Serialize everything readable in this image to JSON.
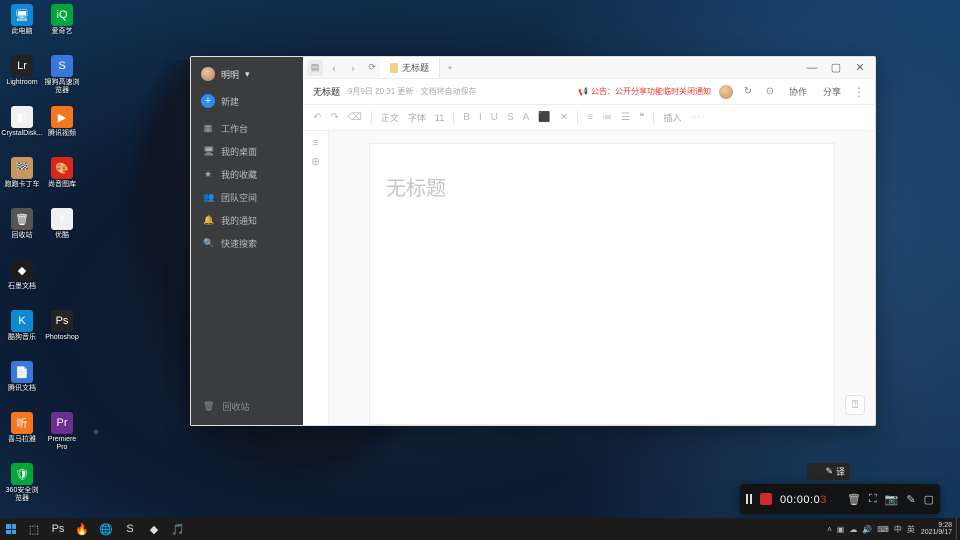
{
  "desktop_icons": [
    {
      "label": "此电脑",
      "cls": "c-blue",
      "glyph": "🖥"
    },
    {
      "label": "Lightroom",
      "cls": "c-lrblue",
      "glyph": "Lr"
    },
    {
      "label": "CrystalDisk...",
      "cls": "c-white",
      "glyph": "◧"
    },
    {
      "label": "跑跑卡丁车",
      "cls": "c-tan",
      "glyph": "🏁"
    },
    {
      "label": "回收站",
      "cls": "c-grey",
      "glyph": "🗑"
    },
    {
      "label": "石墨文档",
      "cls": "c-dark",
      "glyph": "◆"
    },
    {
      "label": "酷狗音乐",
      "cls": "c-blue",
      "glyph": "K"
    },
    {
      "label": "腾讯文档",
      "cls": "c-sblue",
      "glyph": "📄"
    },
    {
      "label": "喜马拉雅",
      "cls": "c-orange",
      "glyph": "听"
    },
    {
      "label": "360安全浏览器",
      "cls": "c-green",
      "glyph": "🛡"
    },
    {
      "label": "爱奇艺",
      "cls": "c-green",
      "glyph": "iQ"
    },
    {
      "label": "搜狗高速浏览器",
      "cls": "c-sblue",
      "glyph": "S"
    },
    {
      "label": "腾讯视频",
      "cls": "c-orange",
      "glyph": "▶"
    },
    {
      "label": "尚音图库",
      "cls": "c-red",
      "glyph": "🎨"
    },
    {
      "label": "优酷",
      "cls": "c-white",
      "glyph": "Y"
    },
    {
      "label": "",
      "cls": "",
      "glyph": ""
    },
    {
      "label": "Photoshop",
      "cls": "c-lrblue",
      "glyph": "Ps"
    },
    {
      "label": "",
      "cls": "",
      "glyph": ""
    },
    {
      "label": "Premiere Pro",
      "cls": "c-purple",
      "glyph": "Pr"
    }
  ],
  "app": {
    "user_name": "明明",
    "user_chevron": "▾",
    "new_label": "新建",
    "nav": [
      {
        "icon": "▦",
        "label": "工作台"
      },
      {
        "icon": "🖥",
        "label": "我的桌面"
      },
      {
        "icon": "★",
        "label": "我的收藏"
      },
      {
        "icon": "👥",
        "label": "团队空间"
      },
      {
        "icon": "🔔",
        "label": "我的通知"
      },
      {
        "icon": "🔍",
        "label": "快速搜索"
      }
    ],
    "trash": "回收站",
    "tab_title": "无标题",
    "doc_title": "无标题",
    "doc_meta": "9月9日 20:31 更新 · 文档将自动保存",
    "announce": "公告：公开分享功能临时关闭通知",
    "collab": "协作",
    "share": "分享",
    "toolbar": {
      "undo": "↶",
      "redo": "↷",
      "format": "⌫",
      "para": "正文",
      "font": "字体",
      "size": "11",
      "bold": "B",
      "italic": "I",
      "underline": "U",
      "strike": "S",
      "color": "A",
      "hl": "⬛",
      "clear": "✕",
      "align": "≡",
      "list1": "≔",
      "list2": "☰",
      "quote": "❝",
      "insert": "插入",
      "more": "⋯"
    },
    "placeholder_h1": "无标题"
  },
  "recorder": {
    "time_done": "00:00:0",
    "time_live": "3"
  },
  "translator_label": "译",
  "taskbar": {
    "tasks_glyphs": [
      "⬚",
      "Ps",
      "🔥",
      "🌐",
      "S",
      "◆",
      "🎵"
    ],
    "tray_glyphs": [
      "˄",
      "▣",
      "☁",
      "🔊",
      "⌨",
      "中",
      "英"
    ],
    "time": "9:28",
    "date": "2021/9/17"
  }
}
